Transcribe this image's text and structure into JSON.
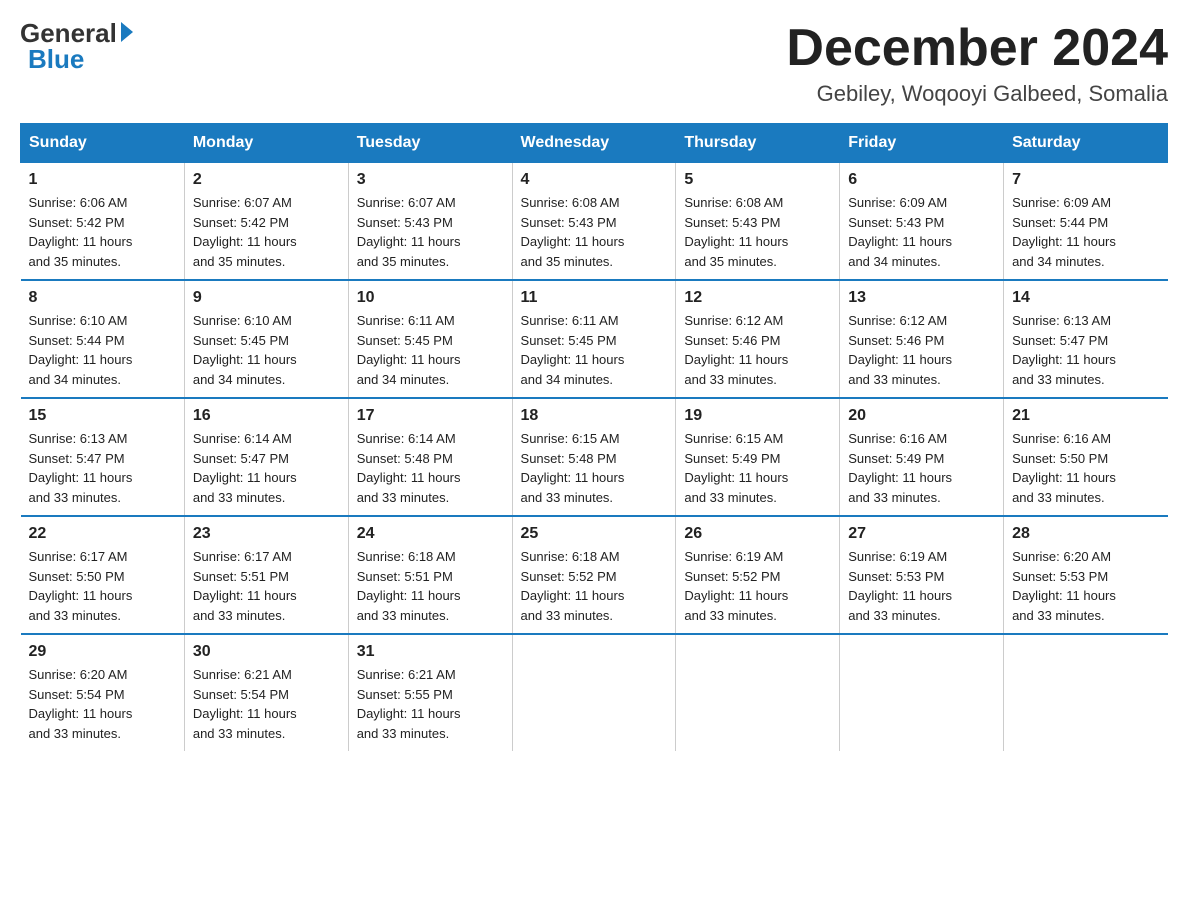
{
  "logo": {
    "general": "General",
    "blue": "Blue",
    "triangle": "▶"
  },
  "title": {
    "month": "December 2024",
    "location": "Gebiley, Woqooyi Galbeed, Somalia"
  },
  "weekdays": [
    "Sunday",
    "Monday",
    "Tuesday",
    "Wednesday",
    "Thursday",
    "Friday",
    "Saturday"
  ],
  "weeks": [
    [
      {
        "day": "1",
        "sunrise": "6:06 AM",
        "sunset": "5:42 PM",
        "daylight": "11 hours and 35 minutes."
      },
      {
        "day": "2",
        "sunrise": "6:07 AM",
        "sunset": "5:42 PM",
        "daylight": "11 hours and 35 minutes."
      },
      {
        "day": "3",
        "sunrise": "6:07 AM",
        "sunset": "5:43 PM",
        "daylight": "11 hours and 35 minutes."
      },
      {
        "day": "4",
        "sunrise": "6:08 AM",
        "sunset": "5:43 PM",
        "daylight": "11 hours and 35 minutes."
      },
      {
        "day": "5",
        "sunrise": "6:08 AM",
        "sunset": "5:43 PM",
        "daylight": "11 hours and 35 minutes."
      },
      {
        "day": "6",
        "sunrise": "6:09 AM",
        "sunset": "5:43 PM",
        "daylight": "11 hours and 34 minutes."
      },
      {
        "day": "7",
        "sunrise": "6:09 AM",
        "sunset": "5:44 PM",
        "daylight": "11 hours and 34 minutes."
      }
    ],
    [
      {
        "day": "8",
        "sunrise": "6:10 AM",
        "sunset": "5:44 PM",
        "daylight": "11 hours and 34 minutes."
      },
      {
        "day": "9",
        "sunrise": "6:10 AM",
        "sunset": "5:45 PM",
        "daylight": "11 hours and 34 minutes."
      },
      {
        "day": "10",
        "sunrise": "6:11 AM",
        "sunset": "5:45 PM",
        "daylight": "11 hours and 34 minutes."
      },
      {
        "day": "11",
        "sunrise": "6:11 AM",
        "sunset": "5:45 PM",
        "daylight": "11 hours and 34 minutes."
      },
      {
        "day": "12",
        "sunrise": "6:12 AM",
        "sunset": "5:46 PM",
        "daylight": "11 hours and 33 minutes."
      },
      {
        "day": "13",
        "sunrise": "6:12 AM",
        "sunset": "5:46 PM",
        "daylight": "11 hours and 33 minutes."
      },
      {
        "day": "14",
        "sunrise": "6:13 AM",
        "sunset": "5:47 PM",
        "daylight": "11 hours and 33 minutes."
      }
    ],
    [
      {
        "day": "15",
        "sunrise": "6:13 AM",
        "sunset": "5:47 PM",
        "daylight": "11 hours and 33 minutes."
      },
      {
        "day": "16",
        "sunrise": "6:14 AM",
        "sunset": "5:47 PM",
        "daylight": "11 hours and 33 minutes."
      },
      {
        "day": "17",
        "sunrise": "6:14 AM",
        "sunset": "5:48 PM",
        "daylight": "11 hours and 33 minutes."
      },
      {
        "day": "18",
        "sunrise": "6:15 AM",
        "sunset": "5:48 PM",
        "daylight": "11 hours and 33 minutes."
      },
      {
        "day": "19",
        "sunrise": "6:15 AM",
        "sunset": "5:49 PM",
        "daylight": "11 hours and 33 minutes."
      },
      {
        "day": "20",
        "sunrise": "6:16 AM",
        "sunset": "5:49 PM",
        "daylight": "11 hours and 33 minutes."
      },
      {
        "day": "21",
        "sunrise": "6:16 AM",
        "sunset": "5:50 PM",
        "daylight": "11 hours and 33 minutes."
      }
    ],
    [
      {
        "day": "22",
        "sunrise": "6:17 AM",
        "sunset": "5:50 PM",
        "daylight": "11 hours and 33 minutes."
      },
      {
        "day": "23",
        "sunrise": "6:17 AM",
        "sunset": "5:51 PM",
        "daylight": "11 hours and 33 minutes."
      },
      {
        "day": "24",
        "sunrise": "6:18 AM",
        "sunset": "5:51 PM",
        "daylight": "11 hours and 33 minutes."
      },
      {
        "day": "25",
        "sunrise": "6:18 AM",
        "sunset": "5:52 PM",
        "daylight": "11 hours and 33 minutes."
      },
      {
        "day": "26",
        "sunrise": "6:19 AM",
        "sunset": "5:52 PM",
        "daylight": "11 hours and 33 minutes."
      },
      {
        "day": "27",
        "sunrise": "6:19 AM",
        "sunset": "5:53 PM",
        "daylight": "11 hours and 33 minutes."
      },
      {
        "day": "28",
        "sunrise": "6:20 AM",
        "sunset": "5:53 PM",
        "daylight": "11 hours and 33 minutes."
      }
    ],
    [
      {
        "day": "29",
        "sunrise": "6:20 AM",
        "sunset": "5:54 PM",
        "daylight": "11 hours and 33 minutes."
      },
      {
        "day": "30",
        "sunrise": "6:21 AM",
        "sunset": "5:54 PM",
        "daylight": "11 hours and 33 minutes."
      },
      {
        "day": "31",
        "sunrise": "6:21 AM",
        "sunset": "5:55 PM",
        "daylight": "11 hours and 33 minutes."
      },
      null,
      null,
      null,
      null
    ]
  ],
  "labels": {
    "sunrise": "Sunrise:",
    "sunset": "Sunset:",
    "daylight": "Daylight:"
  }
}
